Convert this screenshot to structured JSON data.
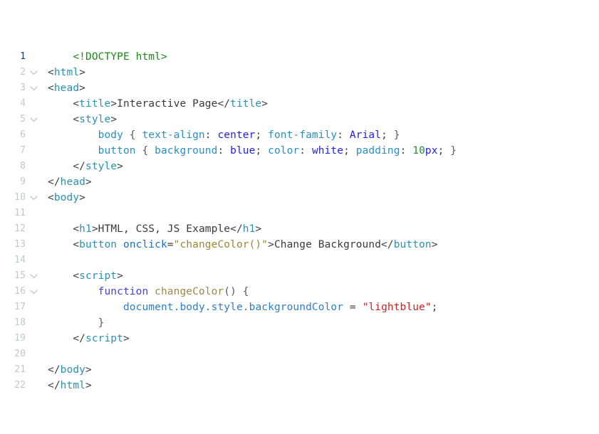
{
  "editor": {
    "language": "html",
    "background_color": "#ffffff",
    "active_line": 1,
    "total_lines": 22,
    "gutter_color": "#c3c7cb",
    "active_line_number_color": "#1c3766"
  },
  "theme": {
    "doctype": "#1a8a1a",
    "tag": "#2b91af",
    "punctuation": "#3f3f3f",
    "attribute_name": "#1f6fc4",
    "attribute_string": "#9c8836",
    "css_selector": "#2b8fc0",
    "css_property": "#2b8fc0",
    "css_value": "#2222dd",
    "number": "#2a8a3e",
    "js_keyword": "#4343d4",
    "js_function": "#9c8a4a",
    "js_object": "#2f7fc4",
    "js_string": "#cc2222",
    "plain_text": "#3a3a3a"
  },
  "lines": [
    {
      "number": "1",
      "fold": false,
      "active": true,
      "tokens": [
        {
          "text": "    ",
          "cls": "t-punct"
        },
        {
          "text": "<!DOCTYPE html>",
          "cls": "t-doctype"
        }
      ]
    },
    {
      "number": "2",
      "fold": true,
      "active": false,
      "tokens": [
        {
          "text": "<",
          "cls": "t-punct"
        },
        {
          "text": "html",
          "cls": "t-tag"
        },
        {
          "text": ">",
          "cls": "t-punct"
        }
      ]
    },
    {
      "number": "3",
      "fold": true,
      "active": false,
      "tokens": [
        {
          "text": "<",
          "cls": "t-punct"
        },
        {
          "text": "head",
          "cls": "t-tag"
        },
        {
          "text": ">",
          "cls": "t-punct"
        }
      ]
    },
    {
      "number": "4",
      "fold": false,
      "active": false,
      "tokens": [
        {
          "text": "    <",
          "cls": "t-punct"
        },
        {
          "text": "title",
          "cls": "t-tag"
        },
        {
          "text": ">",
          "cls": "t-punct"
        },
        {
          "text": "Interactive Page",
          "cls": "t-text"
        },
        {
          "text": "</",
          "cls": "t-punct"
        },
        {
          "text": "title",
          "cls": "t-tag"
        },
        {
          "text": ">",
          "cls": "t-punct"
        }
      ]
    },
    {
      "number": "5",
      "fold": true,
      "active": false,
      "tokens": [
        {
          "text": "    <",
          "cls": "t-punct"
        },
        {
          "text": "style",
          "cls": "t-tag"
        },
        {
          "text": ">",
          "cls": "t-punct"
        }
      ]
    },
    {
      "number": "6",
      "fold": false,
      "active": false,
      "tokens": [
        {
          "text": "        ",
          "cls": "t-punct"
        },
        {
          "text": "body",
          "cls": "t-sel"
        },
        {
          "text": " { ",
          "cls": "t-brace"
        },
        {
          "text": "text-align",
          "cls": "t-prop"
        },
        {
          "text": ": ",
          "cls": "t-punct"
        },
        {
          "text": "center",
          "cls": "t-val"
        },
        {
          "text": "; ",
          "cls": "t-punct"
        },
        {
          "text": "font-family",
          "cls": "t-prop"
        },
        {
          "text": ": ",
          "cls": "t-punct"
        },
        {
          "text": "Arial",
          "cls": "t-val"
        },
        {
          "text": "; ",
          "cls": "t-punct"
        },
        {
          "text": "}",
          "cls": "t-brace"
        }
      ]
    },
    {
      "number": "7",
      "fold": false,
      "active": false,
      "tokens": [
        {
          "text": "        ",
          "cls": "t-punct"
        },
        {
          "text": "button",
          "cls": "t-sel"
        },
        {
          "text": " { ",
          "cls": "t-brace"
        },
        {
          "text": "background",
          "cls": "t-prop"
        },
        {
          "text": ": ",
          "cls": "t-punct"
        },
        {
          "text": "blue",
          "cls": "t-val"
        },
        {
          "text": "; ",
          "cls": "t-punct"
        },
        {
          "text": "color",
          "cls": "t-prop"
        },
        {
          "text": ": ",
          "cls": "t-punct"
        },
        {
          "text": "white",
          "cls": "t-val"
        },
        {
          "text": "; ",
          "cls": "t-punct"
        },
        {
          "text": "padding",
          "cls": "t-prop"
        },
        {
          "text": ": ",
          "cls": "t-punct"
        },
        {
          "text": "10",
          "cls": "t-num"
        },
        {
          "text": "px",
          "cls": "t-unit"
        },
        {
          "text": "; ",
          "cls": "t-punct"
        },
        {
          "text": "}",
          "cls": "t-brace"
        }
      ]
    },
    {
      "number": "8",
      "fold": false,
      "active": false,
      "tokens": [
        {
          "text": "    </",
          "cls": "t-punct"
        },
        {
          "text": "style",
          "cls": "t-tag"
        },
        {
          "text": ">",
          "cls": "t-punct"
        }
      ]
    },
    {
      "number": "9",
      "fold": false,
      "active": false,
      "tokens": [
        {
          "text": "</",
          "cls": "t-punct"
        },
        {
          "text": "head",
          "cls": "t-tag"
        },
        {
          "text": ">",
          "cls": "t-punct"
        }
      ]
    },
    {
      "number": "10",
      "fold": true,
      "active": false,
      "tokens": [
        {
          "text": "<",
          "cls": "t-punct"
        },
        {
          "text": "body",
          "cls": "t-tag"
        },
        {
          "text": ">",
          "cls": "t-punct"
        }
      ]
    },
    {
      "number": "11",
      "fold": false,
      "active": false,
      "tokens": []
    },
    {
      "number": "12",
      "fold": false,
      "active": false,
      "tokens": [
        {
          "text": "    <",
          "cls": "t-punct"
        },
        {
          "text": "h1",
          "cls": "t-tag"
        },
        {
          "text": ">",
          "cls": "t-punct"
        },
        {
          "text": "HTML, CSS, JS Example",
          "cls": "t-text"
        },
        {
          "text": "</",
          "cls": "t-punct"
        },
        {
          "text": "h1",
          "cls": "t-tag"
        },
        {
          "text": ">",
          "cls": "t-punct"
        }
      ]
    },
    {
      "number": "13",
      "fold": false,
      "active": false,
      "tokens": [
        {
          "text": "    <",
          "cls": "t-punct"
        },
        {
          "text": "button",
          "cls": "t-tag"
        },
        {
          "text": " ",
          "cls": "t-punct"
        },
        {
          "text": "onclick",
          "cls": "t-attr"
        },
        {
          "text": "=",
          "cls": "t-punct"
        },
        {
          "text": "\"changeColor()\"",
          "cls": "t-attrstr"
        },
        {
          "text": ">",
          "cls": "t-punct"
        },
        {
          "text": "Change Background",
          "cls": "t-text"
        },
        {
          "text": "</",
          "cls": "t-punct"
        },
        {
          "text": "button",
          "cls": "t-tag"
        },
        {
          "text": ">",
          "cls": "t-punct"
        }
      ]
    },
    {
      "number": "14",
      "fold": false,
      "active": false,
      "tokens": []
    },
    {
      "number": "15",
      "fold": true,
      "active": false,
      "tokens": [
        {
          "text": "    <",
          "cls": "t-punct"
        },
        {
          "text": "script",
          "cls": "t-tag"
        },
        {
          "text": ">",
          "cls": "t-punct"
        }
      ]
    },
    {
      "number": "16",
      "fold": true,
      "active": false,
      "tokens": [
        {
          "text": "        ",
          "cls": "t-punct"
        },
        {
          "text": "function",
          "cls": "t-kw"
        },
        {
          "text": " ",
          "cls": "t-punct"
        },
        {
          "text": "changeColor",
          "cls": "t-fn"
        },
        {
          "text": "() {",
          "cls": "t-brace"
        }
      ]
    },
    {
      "number": "17",
      "fold": false,
      "active": false,
      "tokens": [
        {
          "text": "            ",
          "cls": "t-punct"
        },
        {
          "text": "document",
          "cls": "t-obj"
        },
        {
          "text": ".",
          "cls": "t-dot"
        },
        {
          "text": "body",
          "cls": "t-obj"
        },
        {
          "text": ".",
          "cls": "t-dot"
        },
        {
          "text": "style",
          "cls": "t-obj"
        },
        {
          "text": ".",
          "cls": "t-dot"
        },
        {
          "text": "backgroundColor",
          "cls": "t-obj"
        },
        {
          "text": " = ",
          "cls": "t-op"
        },
        {
          "text": "\"lightblue\"",
          "cls": "t-str"
        },
        {
          "text": ";",
          "cls": "t-op"
        }
      ]
    },
    {
      "number": "18",
      "fold": false,
      "active": false,
      "tokens": [
        {
          "text": "        }",
          "cls": "t-brace"
        }
      ]
    },
    {
      "number": "19",
      "fold": false,
      "active": false,
      "tokens": [
        {
          "text": "    </",
          "cls": "t-punct"
        },
        {
          "text": "script",
          "cls": "t-tag"
        },
        {
          "text": ">",
          "cls": "t-punct"
        }
      ]
    },
    {
      "number": "20",
      "fold": false,
      "active": false,
      "tokens": []
    },
    {
      "number": "21",
      "fold": false,
      "active": false,
      "tokens": [
        {
          "text": "</",
          "cls": "t-punct"
        },
        {
          "text": "body",
          "cls": "t-tag"
        },
        {
          "text": ">",
          "cls": "t-punct"
        }
      ]
    },
    {
      "number": "22",
      "fold": false,
      "active": false,
      "tokens": [
        {
          "text": "</",
          "cls": "t-punct"
        },
        {
          "text": "html",
          "cls": "t-tag"
        },
        {
          "text": ">",
          "cls": "t-punct"
        }
      ]
    }
  ]
}
